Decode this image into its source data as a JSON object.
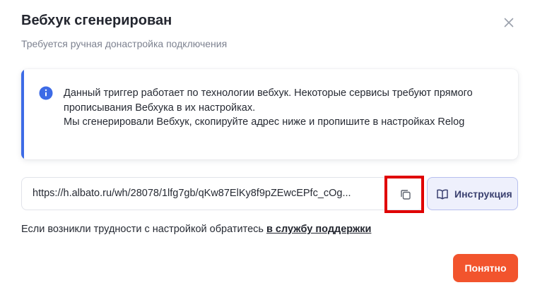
{
  "modal": {
    "title": "Вебхук сгенерирован",
    "subtitle": "Требуется ручная донастройка подключения"
  },
  "info": {
    "line1": "Данный триггер работает по технологии вебхук. Некоторые сервисы требуют прямого прописывания Вебхука в их настройках.",
    "line2": "Мы сгенерировали Вебхук, скопируйте адрес ниже и пропишите в настройках Relog",
    "icon": "info-icon",
    "accent_color": "#3d6be6"
  },
  "webhook": {
    "url": "https://h.albato.ru/wh/28078/1lfg7gb/qKw87ElKy8f9pZEwcEPfc_cOg..."
  },
  "buttons": {
    "copy_icon": "copy-icon",
    "instruction_label": "Инструкция",
    "instruction_icon": "book-icon",
    "ok_label": "Понятно",
    "ok_color": "#f2542d"
  },
  "help": {
    "text": "Если возникли трудности с настройкой обратитесь",
    "link": "в службу поддержки"
  },
  "highlight_color": "#e00000"
}
